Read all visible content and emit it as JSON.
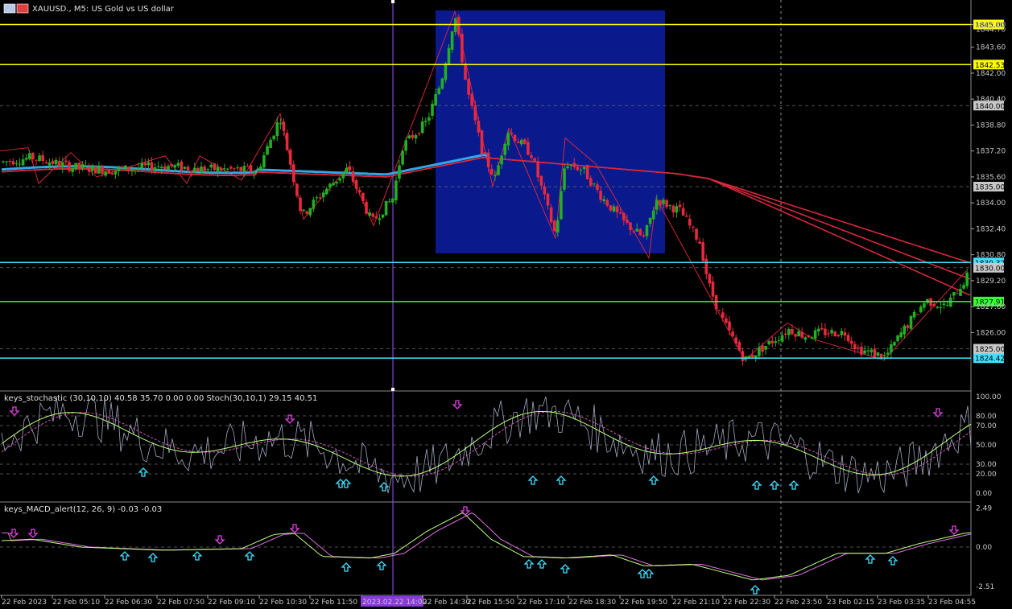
{
  "main": {
    "symbol": "XAUUSD.",
    "timeframe": "M5",
    "description": "US Gold vs US dollar",
    "title_text": "XAUUSD., M5:  US Gold vs US dollar",
    "y_ticks": [
      "1845.00",
      "1843.60",
      "1842.00",
      "1840.40",
      "1838.80",
      "1837.20",
      "1835.60",
      "1834.00",
      "1832.40",
      "1830.80",
      "1829.20",
      "1827.60",
      "1826.00"
    ],
    "hlines": [
      {
        "value": "1845.00",
        "color": "#ffff00"
      },
      {
        "value": "1842.53",
        "color": "#ffff00"
      },
      {
        "value": "1830.32",
        "color": "#40e0ff"
      },
      {
        "value": "1827.91",
        "color": "#33ff33"
      },
      {
        "value": "1824.42",
        "color": "#40e0ff"
      }
    ],
    "grid_tags": [
      "1840.00",
      "1835.00",
      "1830.00",
      "1825.00"
    ],
    "top_tag": "1844.70"
  },
  "stoch": {
    "title_text": "keys_stochastic (30,10,10) 40.58 35.70 0.00 0.00 Stoch(30,10,1) 29.15 40.51",
    "y_ticks": [
      "100.00",
      "80.00",
      "70.00",
      "50.00",
      "30.00",
      "20.00",
      "0.00"
    ]
  },
  "macd": {
    "title_text": "keys_MACD_alert(12, 26, 9) -0.03 -0.03",
    "y_ticks": [
      "2.49",
      "0.00",
      "-2.51"
    ]
  },
  "time_axis": {
    "labels": [
      "22 Feb 2023",
      "22 Feb 05:10",
      "22 Feb 06:30",
      "22 Feb 07:50",
      "22 Feb 09:10",
      "22 Feb 10:30",
      "22 Feb 11:50",
      "2023.02.22 14:00",
      "22 Feb 14:30",
      "22 Feb 15:50",
      "22 Feb 17:10",
      "22 Feb 18:30",
      "22 Feb 19:50",
      "22 Feb 21:10",
      "22 Feb 22:30",
      "22 Feb 23:50",
      "23 Feb 02:15",
      "23 Feb 03:35",
      "23 Feb 04:55"
    ]
  },
  "colors": {
    "bull": "#22b022",
    "bear": "#e8283c",
    "ma_red": "#d8283c",
    "ma_blue": "#30a8e8",
    "zone": "#0a1a8c",
    "arrow_up": "#40e0ff",
    "arrow_down": "#e040e0",
    "crosshair": "#9a50ff"
  },
  "chart_data": {
    "type": "candlestick",
    "title": "XAUUSD., M5: US Gold vs US dollar",
    "ylim": [
      1823.0,
      1846.6
    ],
    "key_points": [
      {
        "x": "22 Feb 2023",
        "y": 1836.5
      },
      {
        "x": "22 Feb 09:10",
        "y": 1836.0
      },
      {
        "x": "22 Feb 10:30",
        "y": 1839.4
      },
      {
        "x": "22 Feb 11:50",
        "y": 1833.7
      },
      {
        "x": "2023.02.22 14:00",
        "y": 1834.3
      },
      {
        "x": "22 Feb 14:30",
        "y": 1845.6
      },
      {
        "x": "22 Feb 15:50",
        "y": 1837.0
      },
      {
        "x": "22 Feb 17:10",
        "y": 1832.0
      },
      {
        "x": "22 Feb 18:30",
        "y": 1836.3
      },
      {
        "x": "22 Feb 19:50",
        "y": 1831.7
      },
      {
        "x": "22 Feb 21:10",
        "y": 1830.5
      },
      {
        "x": "22 Feb 22:30",
        "y": 1824.5
      },
      {
        "x": "22 Feb 23:50",
        "y": 1825.7
      },
      {
        "x": "23 Feb 02:15",
        "y": 1825.5
      },
      {
        "x": "23 Feb 03:35",
        "y": 1824.6
      },
      {
        "x": "23 Feb 04:55",
        "y": 1829.3
      }
    ]
  }
}
